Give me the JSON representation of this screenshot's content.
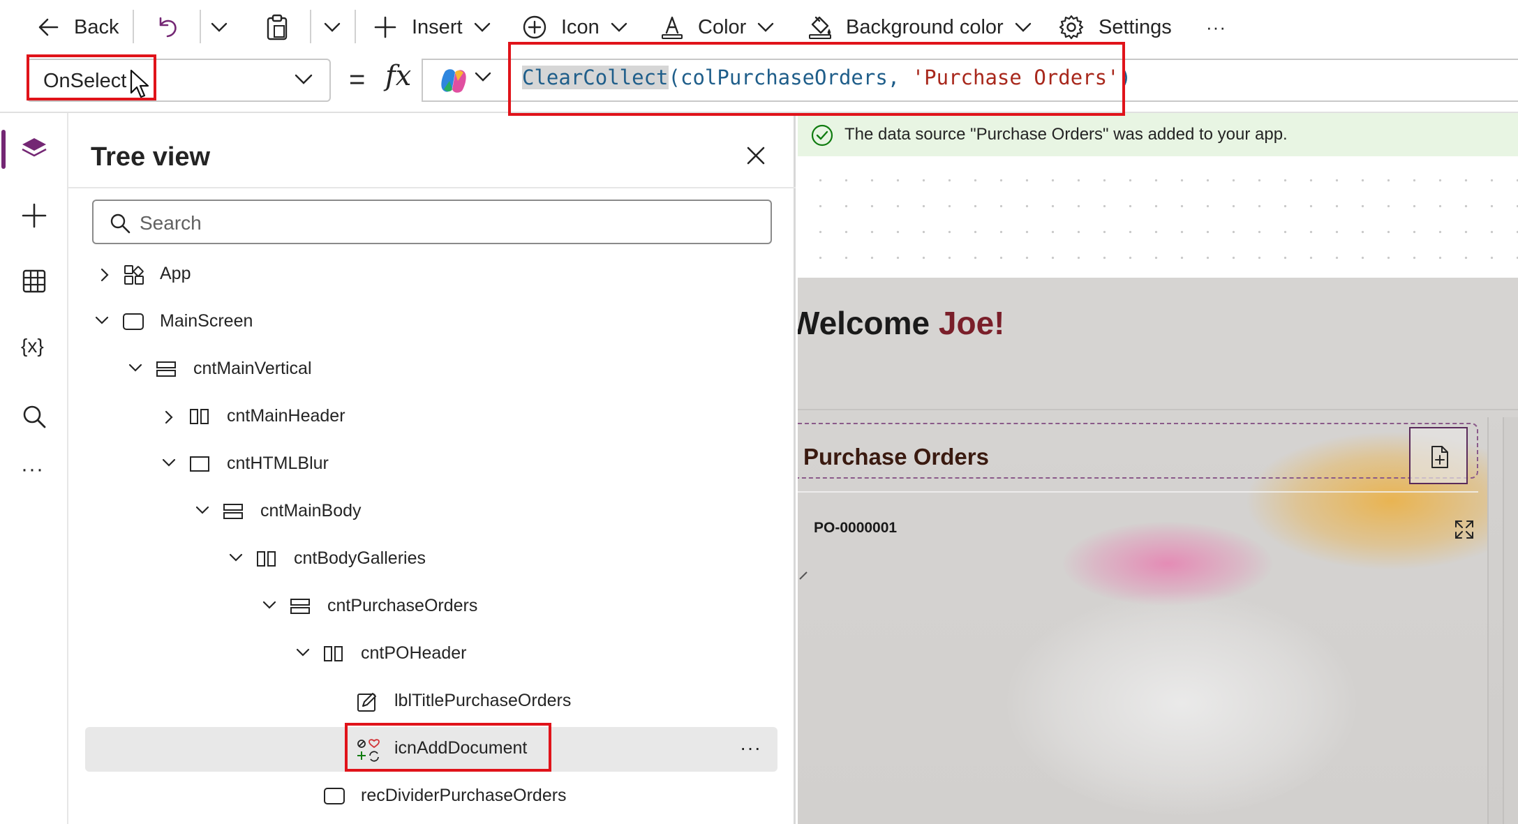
{
  "toolbar": {
    "back_label": "Back",
    "insert_label": "Insert",
    "icon_label": "Icon",
    "color_label": "Color",
    "background_color_label": "Background color",
    "settings_label": "Settings",
    "more_label": "···"
  },
  "formula_bar": {
    "property": "OnSelect",
    "equals": "=",
    "fx": "fx",
    "formula": {
      "function": "ClearCollect",
      "open": "(",
      "arg1": "colPurchaseOrders, ",
      "arg2": "'Purchase Orders'",
      "close": ")"
    }
  },
  "tree_view": {
    "title": "Tree view",
    "search_placeholder": "Search",
    "nodes": [
      {
        "label": "App",
        "icon": "app-icon",
        "chevron": "right"
      },
      {
        "label": "MainScreen",
        "icon": "screen-icon",
        "chevron": "down"
      },
      {
        "label": "cntMainVertical",
        "icon": "vertical-container-icon",
        "chevron": "down"
      },
      {
        "label": "cntMainHeader",
        "icon": "horizontal-container-icon",
        "chevron": "right"
      },
      {
        "label": "cntHTMLBlur",
        "icon": "container-icon",
        "chevron": "down"
      },
      {
        "label": "cntMainBody",
        "icon": "vertical-container-icon",
        "chevron": "down"
      },
      {
        "label": "cntBodyGalleries",
        "icon": "horizontal-container-icon",
        "chevron": "down"
      },
      {
        "label": "cntPurchaseOrders",
        "icon": "vertical-container-icon",
        "chevron": "down"
      },
      {
        "label": "cntPOHeader",
        "icon": "horizontal-container-icon",
        "chevron": "down"
      },
      {
        "label": "lblTitlePurchaseOrders",
        "icon": "label-edit-icon",
        "chevron": "none"
      },
      {
        "label": "icnAddDocument",
        "icon": "icons-control-icon",
        "chevron": "none",
        "selected": true
      },
      {
        "label": "recDividerPurchaseOrders",
        "icon": "rectangle-icon",
        "chevron": "none"
      }
    ],
    "more_label": "···"
  },
  "canvas": {
    "notification": "The data source \"Purchase Orders\" was added to your app.",
    "welcome_prefix": "Welcome ",
    "welcome_name": "Joe!",
    "panel_title": "Purchase Orders",
    "first_po": "PO-0000001"
  },
  "colors": {
    "accent": "#742774",
    "highlight": "#e0131a",
    "success_bg": "#e8f5e3",
    "welcome_name": "#7a1f2a"
  }
}
